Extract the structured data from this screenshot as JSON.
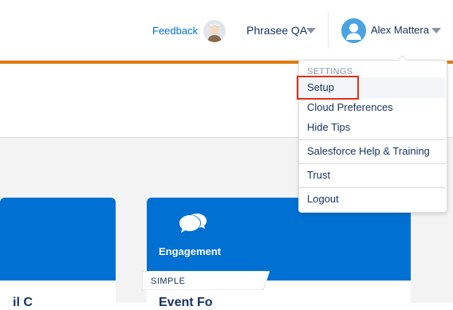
{
  "header": {
    "feedback_label": "Feedback",
    "org_name": "Phrasee QA",
    "user_name": "Alex Mattera"
  },
  "user_menu": {
    "section_heading": "SETTINGS",
    "items": [
      {
        "label": "Setup"
      },
      {
        "label": "Cloud Preferences"
      },
      {
        "label": "Hide Tips"
      },
      {
        "label": "Salesforce Help & Training"
      },
      {
        "label": "Trust"
      },
      {
        "label": "Logout"
      }
    ]
  },
  "cards": {
    "engagement": {
      "title": "Engagement",
      "tag": "SIMPLE",
      "subtitle_partial": "Event Fo"
    },
    "left_subtitle_partial": "il C"
  },
  "colors": {
    "accent": "#e07b0f",
    "card_blue": "#0070d2",
    "link_blue": "#0070d2",
    "highlight_red": "#e0301e"
  },
  "icons": [
    "avatar-icon",
    "chevron-down-icon",
    "user-avatar-icon",
    "chat-bubbles-icon"
  ]
}
